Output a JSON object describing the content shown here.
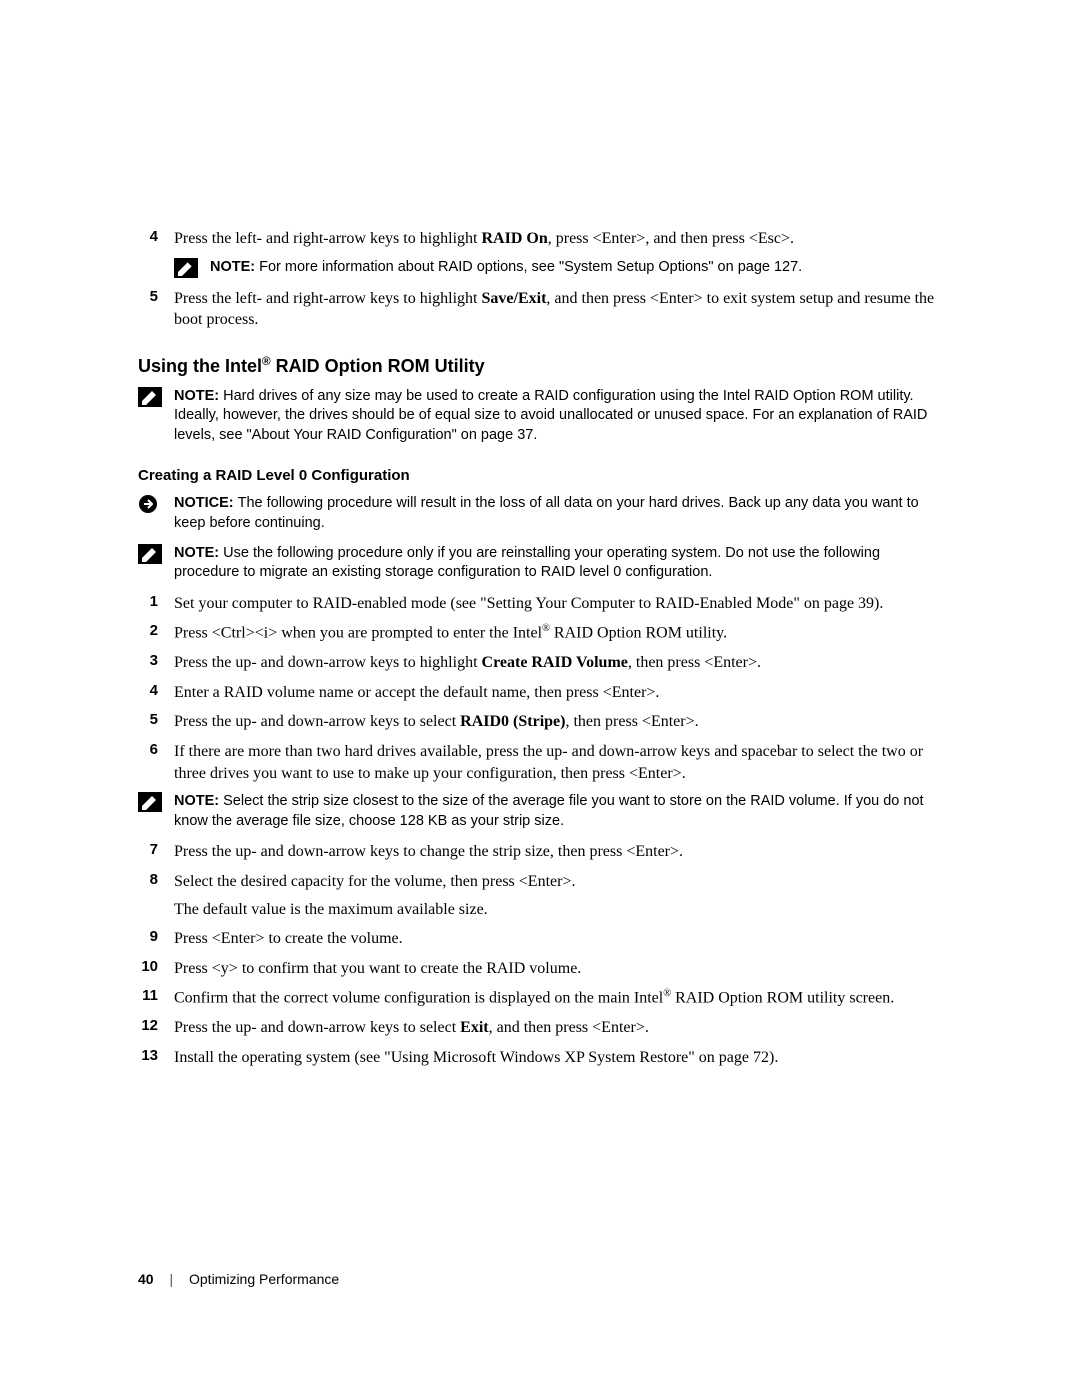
{
  "step4": {
    "text_a": "Press the left- and right-arrow keys to highlight ",
    "bold": "RAID On",
    "text_b": ", press <Enter>, and then press <Esc>."
  },
  "note1": "For more information about RAID options, see \"System Setup Options\" on page 127.",
  "step5": {
    "text_a": "Press the left- and right-arrow keys to highlight ",
    "bold": "Save/Exit",
    "text_b": ", and then press <Enter> to exit system setup and resume the boot process."
  },
  "heading1_a": "Using the Intel",
  "heading1_b": " RAID Option ROM Utility",
  "note2": "Hard drives of any size may be used to create a RAID configuration using the Intel RAID Option ROM utility. Ideally, however, the drives should be of equal size to avoid unallocated or unused space. For an explanation of RAID levels, see \"About Your RAID Configuration\" on page 37.",
  "subheading1": "Creating a RAID Level 0 Configuration",
  "notice1": "The following procedure will result in the loss of all data on your hard drives. Back up any data you want to keep before continuing.",
  "note3": "Use the following procedure only if you are reinstalling your operating system. Do not use the following procedure to migrate an existing storage configuration to RAID level 0 configuration.",
  "s1": "Set your computer to RAID-enabled mode (see \"Setting Your Computer to RAID-Enabled Mode\" on page 39).",
  "s2_a": "Press <Ctrl><i> when you are prompted to enter the Intel",
  "s2_b": " RAID Option ROM utility.",
  "s3_a": "Press the up- and down-arrow keys to highlight ",
  "s3_bold": "Create RAID Volume",
  "s3_b": ", then press <Enter>.",
  "s4": "Enter a RAID volume name or accept the default name, then press <Enter>.",
  "s5_a": "Press the up- and down-arrow keys to select ",
  "s5_bold": "RAID0 (Stripe)",
  "s5_b": ", then press <Enter>.",
  "s6": "If there are more than two hard drives available, press the up- and down-arrow keys and spacebar to select the two or three drives you want to use to make up your configuration, then press <Enter>.",
  "note4": "Select the strip size closest to the size of the average file you want to store on the RAID volume. If you do not know the average file size, choose 128 KB as your strip size.",
  "s7": "Press the up- and down-arrow keys to change the strip size, then press <Enter>.",
  "s8a": "Select the desired capacity for the volume, then press <Enter>.",
  "s8b": "The default value is the maximum available size.",
  "s9": "Press <Enter> to create the volume.",
  "s10": "Press <y> to confirm that you want to create the RAID volume.",
  "s11_a": "Confirm that the correct volume configuration is displayed on the main Intel",
  "s11_b": " RAID Option ROM utility screen.",
  "s12_a": "Press the up- and down-arrow keys to select ",
  "s12_bold": "Exit",
  "s12_b": ", and then press <Enter>.",
  "s13": "Install the operating system (see \"Using Microsoft Windows XP System Restore\" on page 72).",
  "labels": {
    "note": "NOTE: ",
    "notice": "NOTICE: "
  },
  "footer": {
    "page_number": "40",
    "separator": "|",
    "chapter": "Optimizing Performance"
  },
  "icons": {
    "note_svg": "note-pencil",
    "notice_svg": "notice-arrow"
  }
}
